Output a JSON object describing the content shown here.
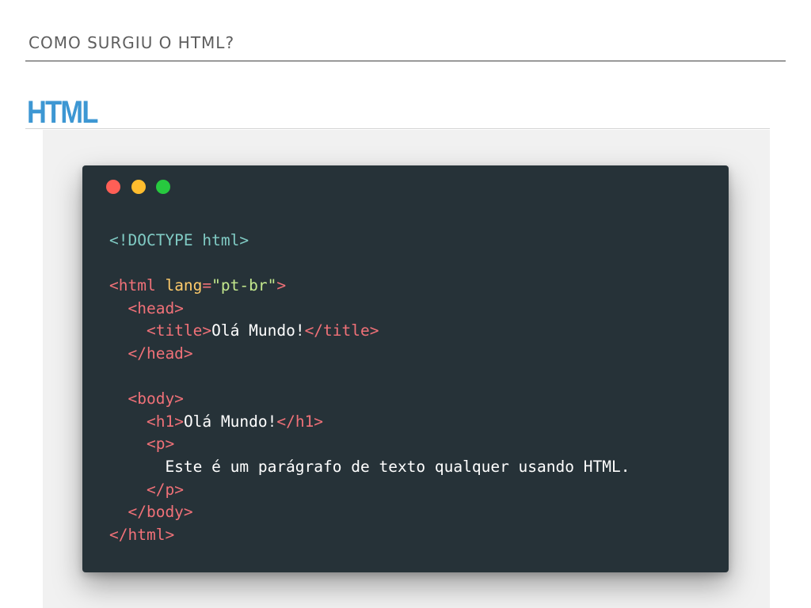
{
  "slide": {
    "section_title": "COMO SURGIU O HTML?",
    "heading": "HTML"
  },
  "code_window": {
    "window_dots": [
      {
        "name": "close",
        "color": "#ff5f56"
      },
      {
        "name": "minimize",
        "color": "#ffbd2e"
      },
      {
        "name": "maximize",
        "color": "#27c93f"
      }
    ],
    "colors": {
      "background": "#263238",
      "doctype": "#80cbc4",
      "tag": "#f07178",
      "attribute": "#ffcb6b",
      "string": "#c3e88d",
      "text": "#ffffff"
    },
    "lines": [
      [
        {
          "text": "<!DOCTYPE html>",
          "type": "doctype"
        }
      ],
      [],
      [
        {
          "text": "<html ",
          "type": "tag"
        },
        {
          "text": "lang",
          "type": "attribute"
        },
        {
          "text": "=",
          "type": "tag"
        },
        {
          "text": "\"pt-br\"",
          "type": "string"
        },
        {
          "text": ">",
          "type": "tag"
        }
      ],
      [
        {
          "text": "  ",
          "type": "text"
        },
        {
          "text": "<head>",
          "type": "tag"
        }
      ],
      [
        {
          "text": "    ",
          "type": "text"
        },
        {
          "text": "<title>",
          "type": "tag"
        },
        {
          "text": "Olá Mundo!",
          "type": "text"
        },
        {
          "text": "</title>",
          "type": "tag"
        }
      ],
      [
        {
          "text": "  ",
          "type": "text"
        },
        {
          "text": "</head>",
          "type": "tag"
        }
      ],
      [],
      [
        {
          "text": "  ",
          "type": "text"
        },
        {
          "text": "<body>",
          "type": "tag"
        }
      ],
      [
        {
          "text": "    ",
          "type": "text"
        },
        {
          "text": "<h1>",
          "type": "tag"
        },
        {
          "text": "Olá Mundo!",
          "type": "text"
        },
        {
          "text": "</h1>",
          "type": "tag"
        }
      ],
      [
        {
          "text": "    ",
          "type": "text"
        },
        {
          "text": "<p>",
          "type": "tag"
        }
      ],
      [
        {
          "text": "      Este é um parágrafo de texto qualquer usando HTML.",
          "type": "text"
        }
      ],
      [
        {
          "text": "    ",
          "type": "text"
        },
        {
          "text": "</p>",
          "type": "tag"
        }
      ],
      [
        {
          "text": "  ",
          "type": "text"
        },
        {
          "text": "</body>",
          "type": "tag"
        }
      ],
      [
        {
          "text": "</html>",
          "type": "tag"
        }
      ]
    ]
  }
}
